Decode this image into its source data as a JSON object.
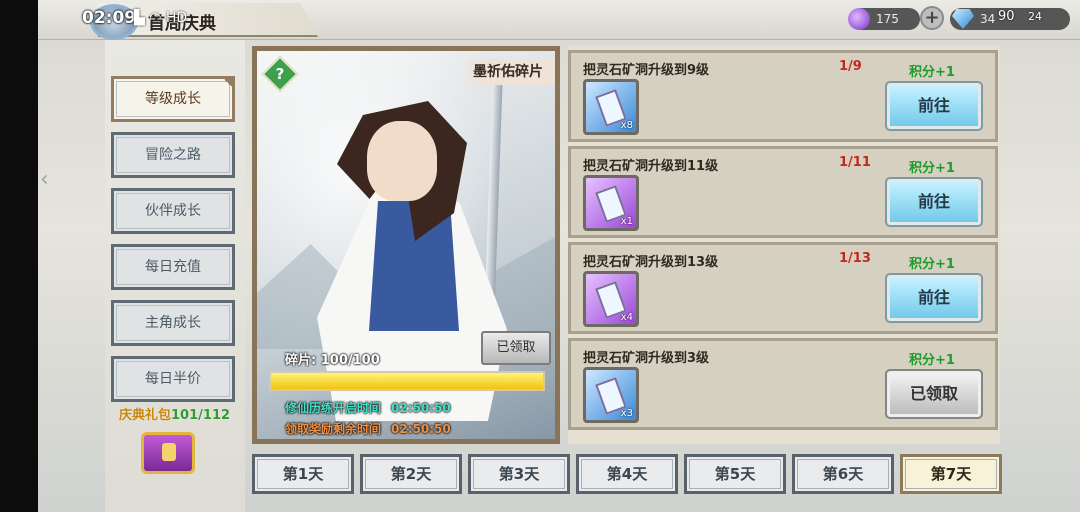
{
  "status_bar": {
    "time": "02:09",
    "icons": "▙ ◠ HD"
  },
  "header": {
    "title": "首周庆典"
  },
  "currency": {
    "primary_value": "175",
    "secondary_value": "34",
    "secondary_overlay": "90",
    "badge": "24"
  },
  "tabs": [
    {
      "label": "等级成长",
      "active": true
    },
    {
      "label": "冒险之路",
      "active": false
    },
    {
      "label": "伙伴成长",
      "active": false
    },
    {
      "label": "每日充值",
      "active": false
    },
    {
      "label": "主角成长",
      "active": false
    },
    {
      "label": "每日半价",
      "active": false
    }
  ],
  "gift": {
    "label": "庆典礼包",
    "count": "101/112"
  },
  "card": {
    "help_icon": "?",
    "name": "墨祈佑碎片",
    "claimed_label": "已领取",
    "fragment_label": "碎片: 100/100",
    "progress": 1.0,
    "timer1_label": "修仙历练开启时间",
    "timer1_value": "02:50:50",
    "timer2_label": "领取奖励剩余时间",
    "timer2_value": "02:50:50"
  },
  "tasks": [
    {
      "title": "把灵石矿洞升级到9级",
      "progress": "1/9",
      "score": "积分+1",
      "item": "blue",
      "qty": "x8",
      "button": "前往",
      "claimed": false
    },
    {
      "title": "把灵石矿洞升级到11级",
      "progress": "1/11",
      "score": "积分+1",
      "item": "purple",
      "qty": "x1",
      "button": "前往",
      "claimed": false
    },
    {
      "title": "把灵石矿洞升级到13级",
      "progress": "1/13",
      "score": "积分+1",
      "item": "purple",
      "qty": "x4",
      "button": "前往",
      "claimed": false
    },
    {
      "title": "把灵石矿洞升级到3级",
      "progress": "",
      "score": "积分+1",
      "item": "blue",
      "qty": "x3",
      "button": "已领取",
      "claimed": true
    }
  ],
  "days": [
    {
      "label": "第1天",
      "active": false
    },
    {
      "label": "第2天",
      "active": false
    },
    {
      "label": "第3天",
      "active": false
    },
    {
      "label": "第4天",
      "active": false
    },
    {
      "label": "第5天",
      "active": false
    },
    {
      "label": "第6天",
      "active": false
    },
    {
      "label": "第7天",
      "active": true
    }
  ],
  "colors": {
    "go_button": "#72c9eb",
    "progress_fill": "#f1c40f",
    "score_green": "#1e9b2c",
    "progress_red": "#c4271c"
  }
}
